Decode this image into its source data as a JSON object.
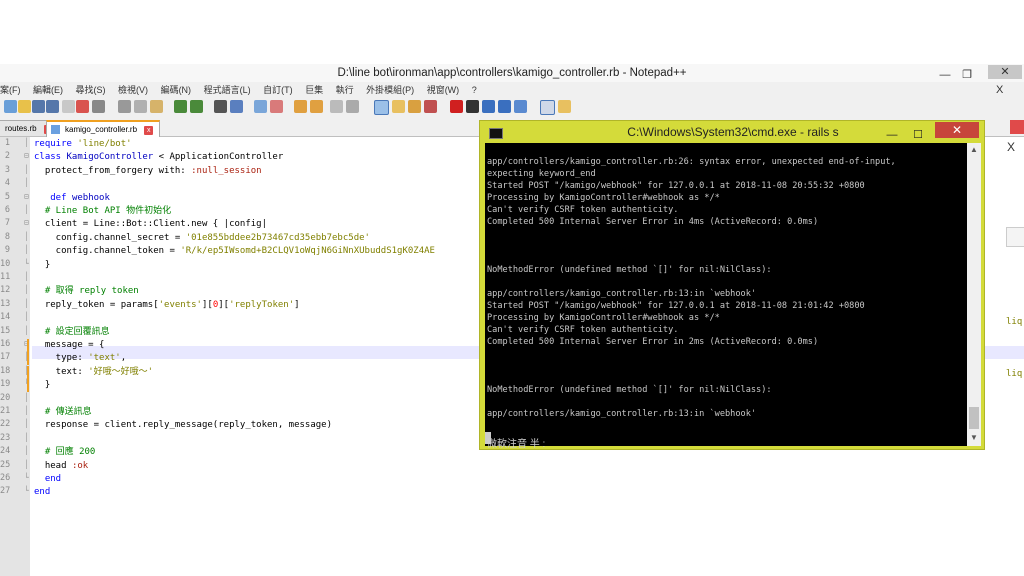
{
  "notepad": {
    "title": "D:\\line bot\\ironman\\app\\controllers\\kamigo_controller.rb - Notepad++",
    "window_buttons": {
      "minimize": "—",
      "maximize": "❐",
      "close": "✕"
    },
    "close_doc": "X",
    "menus": [
      "案(F)",
      "編輯(E)",
      "尋找(S)",
      "檢視(V)",
      "編碼(N)",
      "程式語言(L)",
      "自訂(T)",
      "巨集",
      "執行",
      "外掛模組(P)",
      "視窗(W)",
      "?"
    ],
    "tabs": [
      {
        "label": "routes.rb",
        "active": false
      },
      {
        "label": "kamigo_controller.rb",
        "active": true
      }
    ],
    "right_partial": {
      "close": "X",
      "text1": "liq",
      "text2": "liq"
    }
  },
  "code_lines": [
    {
      "n": "1",
      "html": "<span class=\"kw\">require</span> <span class=\"str\">'line/bot'</span>"
    },
    {
      "n": "2",
      "html": "<span class=\"kw\">class</span> <span class=\"cls\">KamigoController</span> &lt; ApplicationController"
    },
    {
      "n": "3",
      "html": "  protect_from_forgery with: <span class=\"sym\">:null_session</span>"
    },
    {
      "n": "4",
      "html": ""
    },
    {
      "n": "5",
      "html": "   <span class=\"kw\">def</span> <span class=\"cls\">webhook</span>"
    },
    {
      "n": "6",
      "html": "  <span class=\"cmt\"># Line Bot API 物件初始化</span>"
    },
    {
      "n": "7",
      "html": "  client = Line::Bot::Client.new { |config|"
    },
    {
      "n": "8",
      "html": "    config.channel_secret = <span class=\"str\">'01e855bddee2b73467cd35ebb7ebc5de'</span>"
    },
    {
      "n": "9",
      "html": "    config.channel_token = <span class=\"str\">'R/k/ep5IWsomd+B2CLQV1oWqjN6GiNnXUbuddS1gK0Z4AE</span>"
    },
    {
      "n": "10",
      "html": "  }"
    },
    {
      "n": "11",
      "html": ""
    },
    {
      "n": "12",
      "html": "  <span class=\"cmt\"># 取得 reply token</span>"
    },
    {
      "n": "13",
      "html": "  reply_token = params[<span class=\"str\">'events'</span>][<span class=\"num\">0</span>][<span class=\"str\">'replyToken'</span>]"
    },
    {
      "n": "14",
      "html": ""
    },
    {
      "n": "15",
      "html": "  <span class=\"cmt\"># 設定回覆訊息</span>"
    },
    {
      "n": "16",
      "html": "  message = {"
    },
    {
      "n": "17",
      "html": "    type: <span class=\"str\">'text'</span>,"
    },
    {
      "n": "18",
      "html": "    text: <span class=\"str\">'好哦～好哦～'</span>"
    },
    {
      "n": "19",
      "html": "  }"
    },
    {
      "n": "20",
      "html": ""
    },
    {
      "n": "21",
      "html": "  <span class=\"cmt\"># 傳送訊息</span>"
    },
    {
      "n": "22",
      "html": "  response = client.reply_message(reply_token, message)"
    },
    {
      "n": "23",
      "html": ""
    },
    {
      "n": "24",
      "html": "  <span class=\"cmt\"># 回應 200</span>"
    },
    {
      "n": "25",
      "html": "  head <span class=\"sym\">:ok</span>"
    },
    {
      "n": "26",
      "html": "  <span class=\"kw\">end</span>"
    },
    {
      "n": "27",
      "html": "<span class=\"kw\">end</span>"
    }
  ],
  "cmd": {
    "title": "C:\\Windows\\System32\\cmd.exe - rails  s",
    "buttons": {
      "minimize": "—",
      "maximize": "☐",
      "close": "✕"
    },
    "lines": [
      "app/controllers/kamigo_controller.rb:26: syntax error, unexpected end-of-input,",
      "expecting keyword_end",
      "Started POST \"/kamigo/webhook\" for 127.0.0.1 at 2018-11-08 20:55:32 +0800",
      "Processing by KamigoController#webhook as */*",
      "Can't verify CSRF token authenticity.",
      "Completed 500 Internal Server Error in 4ms (ActiveRecord: 0.0ms)",
      "",
      "",
      "",
      "NoMethodError (undefined method `[]' for nil:NilClass):",
      "",
      "app/controllers/kamigo_controller.rb:13:in `webhook'",
      "Started POST \"/kamigo/webhook\" for 127.0.0.1 at 2018-11-08 21:01:42 +0800",
      "Processing by KamigoController#webhook as */*",
      "Can't verify CSRF token authenticity.",
      "Completed 500 Internal Server Error in 2ms (ActiveRecord: 0.0ms)",
      "",
      "",
      "",
      "NoMethodError (undefined method `[]' for nil:NilClass):",
      "",
      "app/controllers/kamigo_controller.rb:13:in `webhook'"
    ],
    "ime": "微軟注音 半 :"
  },
  "colors": {
    "cmd_frame": "#d4db3a",
    "console_bg": "#000000",
    "close_red": "#c7453b"
  }
}
